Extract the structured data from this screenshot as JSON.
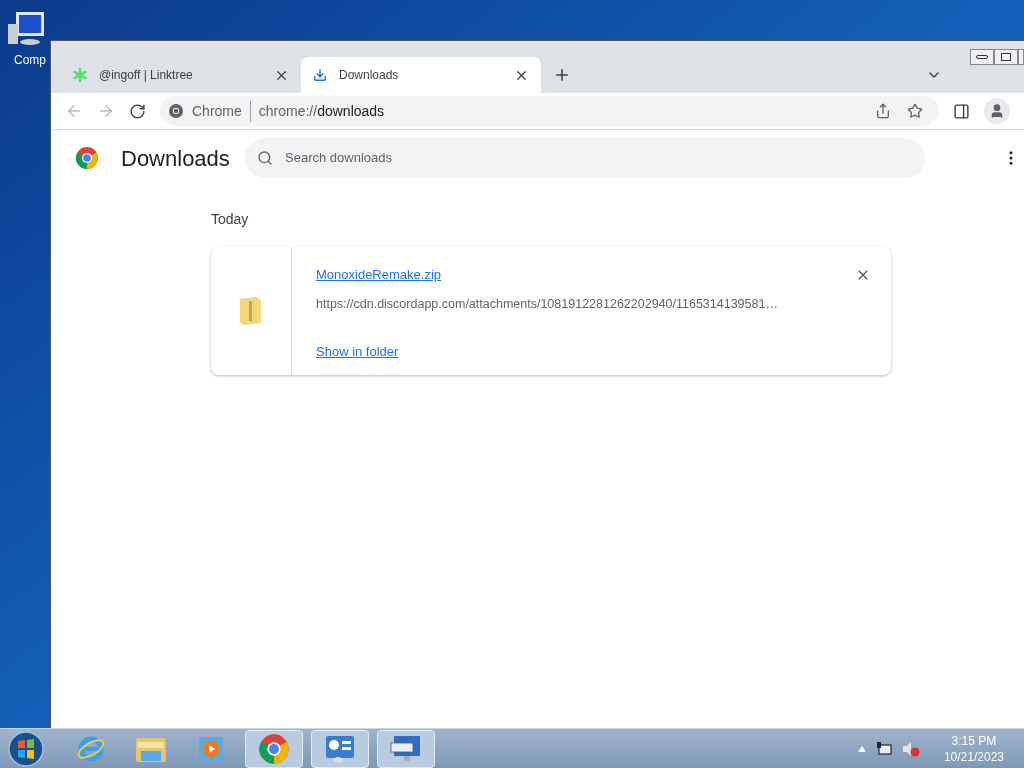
{
  "desktop": {
    "icon_label": "Comp"
  },
  "tabs": [
    {
      "title": "@ingoff | Linktree",
      "selected": false,
      "kind": "linktree"
    },
    {
      "title": "Downloads",
      "selected": true,
      "kind": "download"
    }
  ],
  "omnibox": {
    "chip": "Chrome",
    "url_scheme": "chrome://",
    "url_host": "downloads"
  },
  "page": {
    "title": "Downloads",
    "search_placeholder": "Search downloads",
    "section": "Today",
    "items": [
      {
        "file_name": "MonoxideRemake.zip",
        "url": "https://cdn.discordapp.com/attachments/1081912281262202940/1165314139581…",
        "action": "Show in folder"
      }
    ]
  },
  "taskbar": {
    "apps": [
      {
        "kind": "browser-e",
        "running": false
      },
      {
        "kind": "folder",
        "running": false
      },
      {
        "kind": "media",
        "running": false
      },
      {
        "kind": "chrome",
        "running": true
      },
      {
        "kind": "control-panel",
        "running": true
      },
      {
        "kind": "keyboard",
        "running": true
      }
    ],
    "time": "3:15 PM",
    "date": "10/21/2023"
  }
}
